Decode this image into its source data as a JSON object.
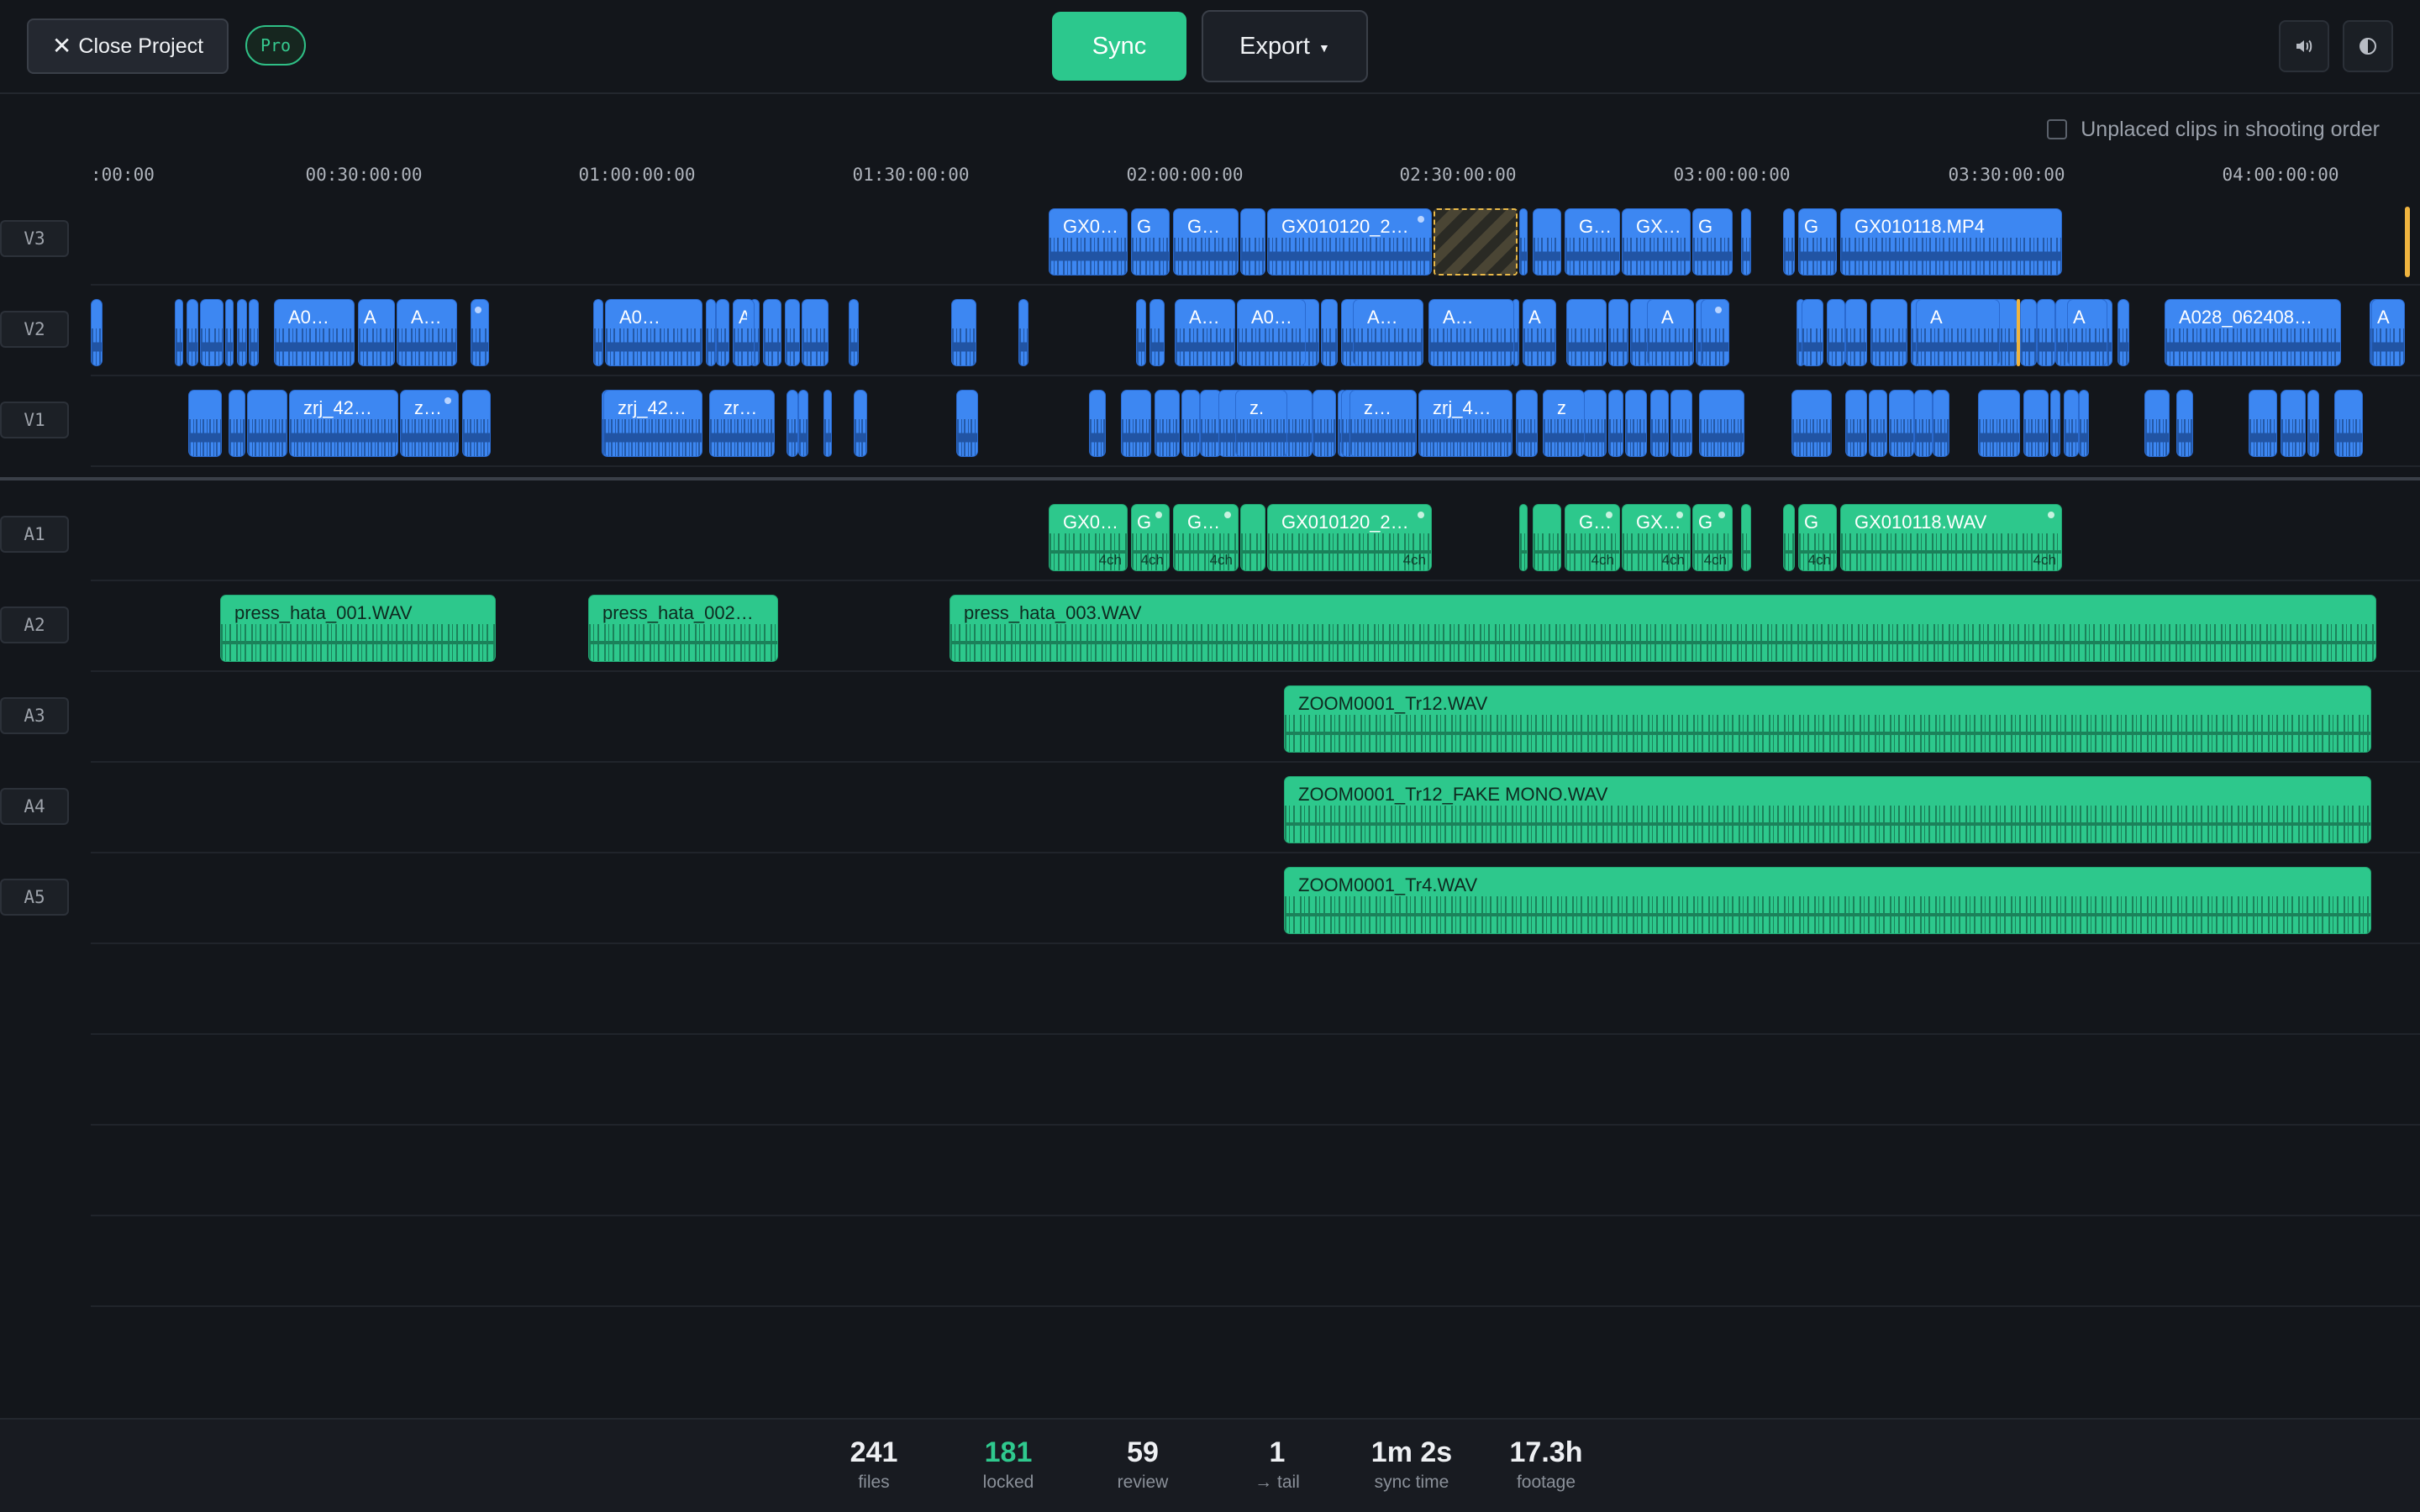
{
  "toolbar": {
    "close_label": "Close Project",
    "pro_badge": "Pro",
    "sync_label": "Sync",
    "export_label": "Export",
    "volume_icon": "volume-icon",
    "theme_icon": "contrast-icon"
  },
  "options": {
    "unplaced_label": "Unplaced clips in shooting order",
    "unplaced_checked": false
  },
  "ruler": {
    "ticks": [
      ":00:00",
      "00:30:00:00",
      "01:00:00:00",
      "01:30:00:00",
      "02:00:00:00",
      "02:30:00:00",
      "03:00:00:00",
      "03:30:00:00",
      "04:00:00:00"
    ]
  },
  "tracks": {
    "video": [
      "V3",
      "V2",
      "V1"
    ],
    "audio": [
      "A1",
      "A2",
      "A3",
      "A4",
      "A5"
    ]
  },
  "clips": {
    "v3": [
      "GX0…",
      "G",
      "G…",
      "GX010120_2…",
      "G…",
      "GX…",
      "G",
      "G",
      "GX010118.MP4"
    ],
    "v2": [
      "A0…",
      "A",
      "A…",
      "A0…",
      "A",
      "A…",
      "A0…",
      "A…",
      "A…",
      "A",
      "A",
      "A",
      "A",
      "A028_062408…",
      "A"
    ],
    "v1": [
      "zrj_42…",
      "z…",
      "zrj_42…",
      "zr…",
      "z.",
      "z…",
      "zrj_4…",
      "z"
    ],
    "a1": [
      "GX0…",
      "G",
      "G…",
      "GX010120_2…",
      "G…",
      "GX…",
      "G",
      "G",
      "GX010118.WAV"
    ],
    "a1_channels": "4ch",
    "a2": [
      "press_hata_001.WAV",
      "press_hata_002…",
      "press_hata_003.WAV"
    ],
    "a3": [
      "ZOOM0001_Tr12.WAV"
    ],
    "a4": [
      "ZOOM0001_Tr12_FAKE MONO.WAV"
    ],
    "a5": [
      "ZOOM0001_Tr4.WAV"
    ]
  },
  "stats": [
    {
      "value": "241",
      "label": "files"
    },
    {
      "value": "181",
      "label": "locked"
    },
    {
      "value": "59",
      "label": "review"
    },
    {
      "value": "1",
      "label": "→ tail"
    },
    {
      "value": "1m 2s",
      "label": "sync time"
    },
    {
      "value": "17.3h",
      "label": "footage"
    }
  ],
  "colors": {
    "accent": "#2cc88d",
    "video_clip": "#3d87f2",
    "audio_clip": "#2dc88c",
    "marker": "#efb43f",
    "background": "#13161b"
  }
}
